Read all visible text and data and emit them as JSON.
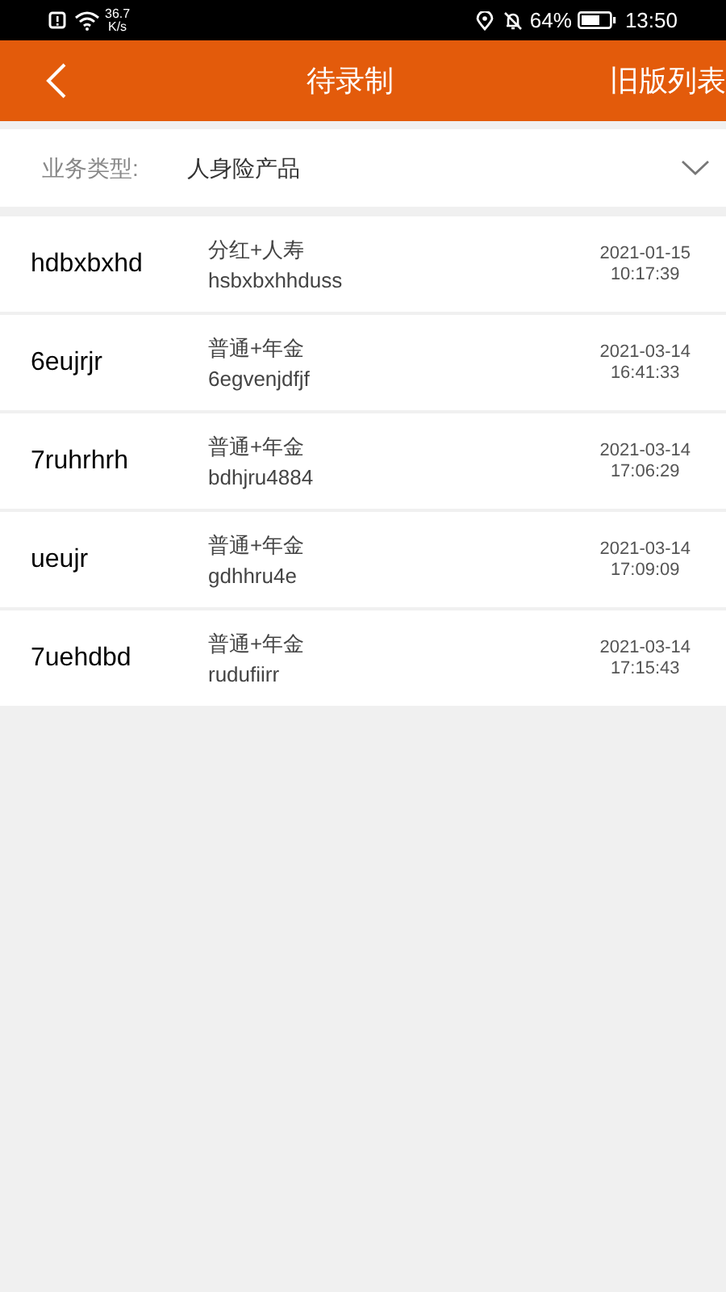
{
  "status_bar": {
    "speed": "36.7",
    "speed_unit": "K/s",
    "battery": "64%",
    "time": "13:50"
  },
  "header": {
    "title": "待录制",
    "action": "旧版列表"
  },
  "filter": {
    "label": "业务类型:",
    "value": "人身险产品"
  },
  "rows": [
    {
      "name": "hdbxbxhd",
      "type": "分红+人寿",
      "code": "hsbxbxhhduss",
      "date": "2021-01-15",
      "time": "10:17:39"
    },
    {
      "name": "6eujrjr",
      "type": "普通+年金",
      "code": "6egvenjdfjf",
      "date": "2021-03-14",
      "time": "16:41:33"
    },
    {
      "name": "7ruhrhrh",
      "type": "普通+年金",
      "code": "bdhjru4884",
      "date": "2021-03-14",
      "time": "17:06:29"
    },
    {
      "name": "ueujr",
      "type": "普通+年金",
      "code": "gdhhru4e",
      "date": "2021-03-14",
      "time": "17:09:09"
    },
    {
      "name": "7uehdbd",
      "type": "普通+年金",
      "code": "rudufiirr",
      "date": "2021-03-14",
      "time": "17:15:43"
    }
  ]
}
